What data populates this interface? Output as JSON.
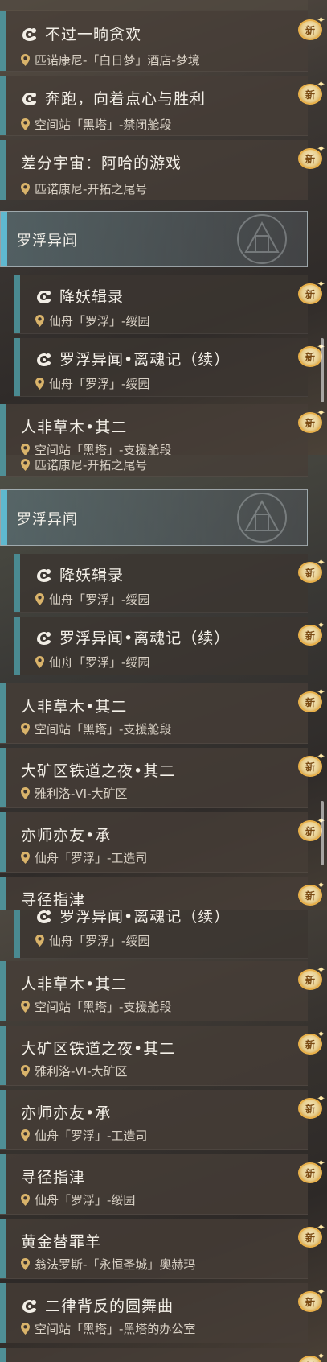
{
  "badge_label": "新",
  "colors": {
    "accent_bar": "#4f8f96",
    "section_bar": "#5fb8cf",
    "badge": "#e8b04a"
  },
  "panel_a": {
    "items": [
      {
        "title": "不过一晌贪欢",
        "location": "匹诺康尼-「白日梦」酒店-梦境",
        "icon": "mission-icon"
      },
      {
        "title": "奔跑，向着点心与胜利",
        "location": "空间站「黑塔」-禁闭舱段",
        "icon": "mission-icon"
      },
      {
        "title": "差分宇宙：阿哈的游戏",
        "location": "匹诺康尼-开拓之尾号"
      }
    ],
    "section_title": "罗浮异闻",
    "sub_items": [
      {
        "title": "降妖辑录",
        "location": "仙舟「罗浮」-绥园"
      },
      {
        "title": "罗浮异闻•离魂记（续）",
        "location": "仙舟「罗浮」-绥园"
      }
    ],
    "last_item": {
      "title": "人非草木•其二",
      "location": "空间站「黑塔」-支援舱段"
    }
  },
  "panel_b": {
    "top_location": "匹诺康尼-开拓之尾号",
    "section_title": "罗浮异闻",
    "sub_items": [
      {
        "title": "降妖辑录",
        "location": "仙舟「罗浮」-绥园"
      },
      {
        "title": "罗浮异闻•离魂记（续）",
        "location": "仙舟「罗浮」-绥园"
      }
    ],
    "items": [
      {
        "title": "人非草木•其二",
        "location": "空间站「黑塔」-支援舱段"
      },
      {
        "title": "大矿区铁道之夜•其二",
        "location": "雅利洛-VI-大矿区"
      },
      {
        "title": "亦师亦友•承",
        "location": "仙舟「罗浮」-工造司"
      },
      {
        "title": "寻径指津"
      }
    ]
  },
  "panel_c": {
    "top_sub": {
      "title": "罗浮异闻•离魂记（续）",
      "location": "仙舟「罗浮」-绥园"
    },
    "items": [
      {
        "title": "人非草木•其二",
        "location": "空间站「黑塔」-支援舱段"
      },
      {
        "title": "大矿区铁道之夜•其二",
        "location": "雅利洛-VI-大矿区"
      },
      {
        "title": "亦师亦友•承",
        "location": "仙舟「罗浮」-工造司"
      },
      {
        "title": "寻径指津",
        "location": "仙舟「罗浮」-绥园"
      },
      {
        "title": "黄金替罪羊",
        "location": "翁法罗斯-「永恒圣城」奥赫玛"
      },
      {
        "title": "二律背反的圆舞曲",
        "location": "空间站「黑塔」-黑塔的办公室",
        "icon": "mission-icon"
      }
    ]
  }
}
